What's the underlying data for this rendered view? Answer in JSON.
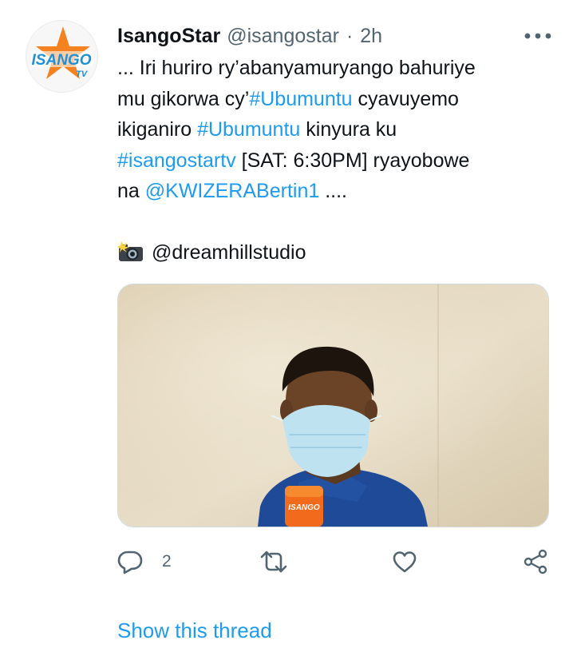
{
  "author": {
    "display_name": "IsangoStar",
    "handle": "@isangostar",
    "separator": "·",
    "timestamp": "2h",
    "avatar_logo_text": "ISANGO TV"
  },
  "tweet": {
    "lines": [
      [
        {
          "t": "... Iri huriro ry’abanyamuryango bahuriye",
          "k": "text"
        }
      ],
      [
        {
          "t": "mu gikorwa cy’",
          "k": "text"
        },
        {
          "t": "#Ubumuntu",
          "k": "link"
        },
        {
          "t": " cyavuyemo",
          "k": "text"
        }
      ],
      [
        {
          "t": "ikiganiro ",
          "k": "text"
        },
        {
          "t": "#Ubumuntu",
          "k": "link"
        },
        {
          "t": " kinyura ku",
          "k": "text"
        }
      ],
      [
        {
          "t": "#isangostartv",
          "k": "link"
        },
        {
          "t": " [SAT: 6:30PM] ryayobowe",
          "k": "text"
        }
      ],
      [
        {
          "t": "na ",
          "k": "text"
        },
        {
          "t": "@KWIZERABertin1",
          "k": "link"
        },
        {
          "t": " ....",
          "k": "text"
        }
      ]
    ],
    "credit": "@dreamhillstudio",
    "microphone_logo_text": "ISANGO"
  },
  "actions": {
    "reply_count": "2"
  },
  "show_thread_label": "Show this thread",
  "colors": {
    "link": "#1d9bf0",
    "secondary_text": "#536471",
    "logo_blue": "#1f8fd8",
    "logo_orange": "#f58220"
  },
  "icons": [
    "more-icon",
    "camera-flash-icon",
    "reply-icon",
    "retweet-icon",
    "like-icon",
    "share-icon"
  ]
}
